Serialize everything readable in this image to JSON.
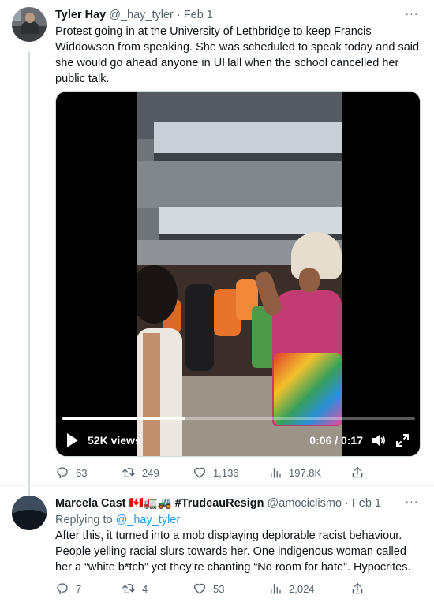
{
  "tweet": {
    "author_name": "Tyler Hay",
    "handle": "@_hay_tyler",
    "separator": "·",
    "date": "Feb 1",
    "more_label": "···",
    "text": "Protest going in at the University of Lethbridge to keep Francis Widdowson from speaking. She was scheduled to speak today and said she would go ahead anyone in UHall when the school cancelled her public talk.",
    "video": {
      "views_label": "52K views",
      "time_label": "0:06 / 0:17",
      "progress_fraction": 0.35
    },
    "actions": {
      "replies": "63",
      "retweets": "249",
      "likes": "1,136",
      "views": "197.8K"
    }
  },
  "reply": {
    "author_name": "Marcela Cast 🇨🇦🚛🚜 #TrudeauResign",
    "handle": "@amociclismo",
    "separator": "·",
    "date": "Feb 1",
    "more_label": "···",
    "replying_to_prefix": "Replying to",
    "replying_to_handle": "@_hay_tyler",
    "text": "After this, it turned into a mob displaying deplorable racist behaviour. People yelling racial slurs towards her.  One indigenous woman called her a “white b*tch” yet they’re chanting “No room for hate”. Hypocrites.",
    "actions": {
      "replies": "7",
      "retweets": "4",
      "likes": "53",
      "views": "2,024"
    }
  },
  "colors": {
    "text_primary": "#0f1419",
    "text_secondary": "#536471",
    "link": "#1d9bf0",
    "thread_line": "#cfd9de"
  }
}
